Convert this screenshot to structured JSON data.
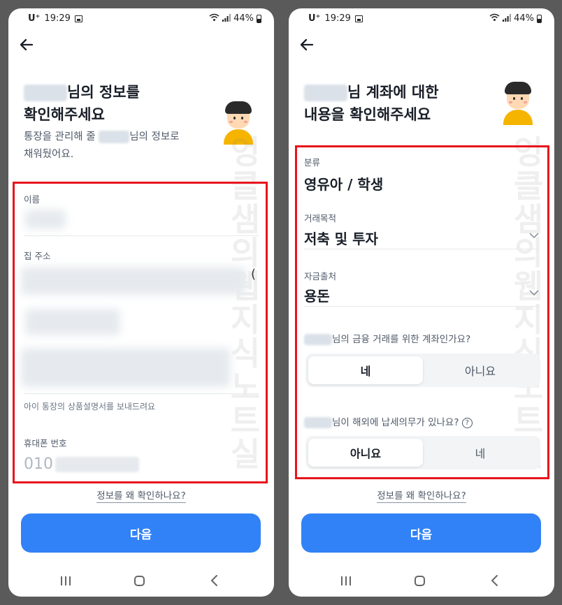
{
  "status_bar": {
    "carrier": "U⁺",
    "time": "19:29",
    "battery": "44%"
  },
  "screen_left": {
    "title_line1_suffix": "님의 정보를",
    "title_line2": "확인해주세요",
    "subtitle_line1_prefix": "통장을 관리해 줄",
    "subtitle_line1_suffix": "님의 정보로",
    "subtitle_line2": "채워뒀어요.",
    "name_label": "이름",
    "address_label": "집 주소",
    "address_partial": "(",
    "address_hint": "아이 통장의 상품설명서를 보내드려요",
    "phone_label": "휴대폰 번호",
    "phone_prefix": "010",
    "watermark": "엉클샘의웹지식노트실",
    "why_link": "정보를 왜 확인하나요?",
    "next_button": "다음"
  },
  "screen_right": {
    "title_line1_suffix": "님 계좌에 대한",
    "title_line2": "내용을 확인해주세요",
    "category_label": "분류",
    "category_value": "영유아 / 학생",
    "purpose_label": "거래목적",
    "purpose_value": "저축 및 투자",
    "source_label": "자금출처",
    "source_value": "용돈",
    "q1_suffix": "님의 금융 거래를 위한 계좌인가요?",
    "q1_options": [
      "네",
      "아니요"
    ],
    "q2_suffix": "님이 해외에 납세의무가 있나요?",
    "q2_help": "?",
    "q2_options": [
      "아니요",
      "네"
    ],
    "watermark": "엉클샘의웹지식노트실",
    "why_link": "정보를 왜 확인하나요?",
    "next_button": "다음"
  },
  "icons": {
    "back": "arrow-left-icon",
    "wifi": "wifi-icon",
    "signal": "signal-icon",
    "battery": "battery-icon",
    "gallery": "image-icon",
    "chevron": "chevron-down-icon",
    "help": "question-circle-icon",
    "nav_recents": "recents-icon",
    "nav_home": "home-icon",
    "nav_back": "nav-back-icon"
  },
  "colors": {
    "primary": "#3182f6",
    "highlight_border": "#e8141c",
    "avatar_shirt": "#f5b400"
  }
}
